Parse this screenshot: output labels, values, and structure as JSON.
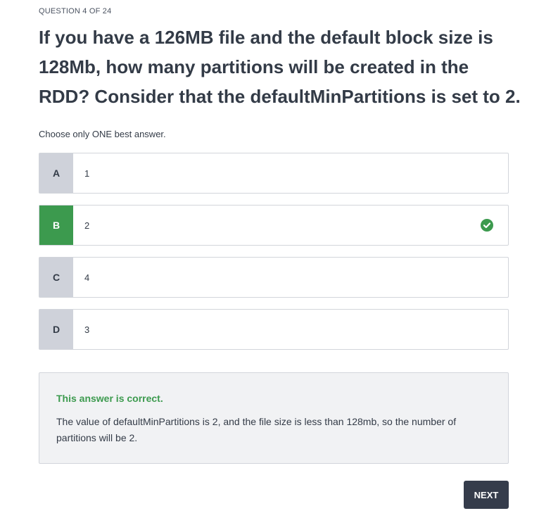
{
  "progress": "QUESTION 4 OF 24",
  "question": "If you have a 126MB file and the default block size is 128Mb, how many partitions will be created in the RDD? Consider that the defaultMinPartitions is set to 2.",
  "instruction": "Choose only ONE best answer.",
  "options": [
    {
      "letter": "A",
      "text": "1",
      "correct": false
    },
    {
      "letter": "B",
      "text": "2",
      "correct": true
    },
    {
      "letter": "C",
      "text": "4",
      "correct": false
    },
    {
      "letter": "D",
      "text": "3",
      "correct": false
    }
  ],
  "feedback": {
    "title": "This answer is correct.",
    "body": "The value of defaultMinPartitions is 2, and the file size is less than 128mb, so the number of partitions will be 2."
  },
  "next_label": "NEXT",
  "colors": {
    "correct": "#3c9a4e",
    "letter_bg": "#cfd2da",
    "button_bg": "#353c4b"
  },
  "icons": {
    "correct_mark": "check-circle-icon"
  }
}
